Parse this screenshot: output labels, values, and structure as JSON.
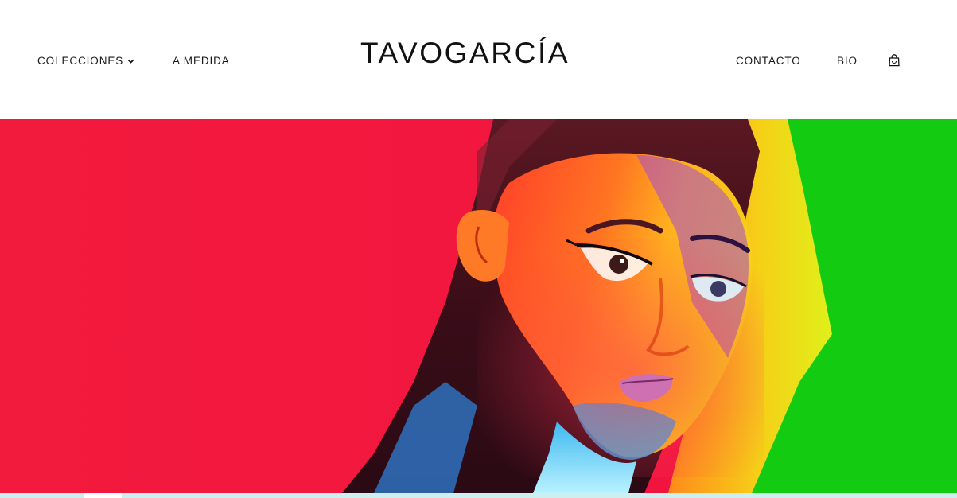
{
  "header": {
    "logo": "TAVOGARCÍA",
    "nav_left": [
      {
        "label": "COLECCIONES",
        "has_dropdown": true
      },
      {
        "label": "A MEDIDA"
      }
    ],
    "nav_right": [
      {
        "label": "CONTACTO"
      },
      {
        "label": "BIO"
      }
    ],
    "cart_icon": "shopping-bag-icon"
  },
  "hero": {
    "image": "model-portrait-colored-lights",
    "colors": {
      "red": "#f2163f",
      "green": "#13cc12",
      "yellow": "#f4d316",
      "cyan": "#1fb8e6"
    }
  },
  "colors": {
    "text": "#1a1a1a",
    "background": "#ffffff",
    "strip": "#cdeff0"
  }
}
